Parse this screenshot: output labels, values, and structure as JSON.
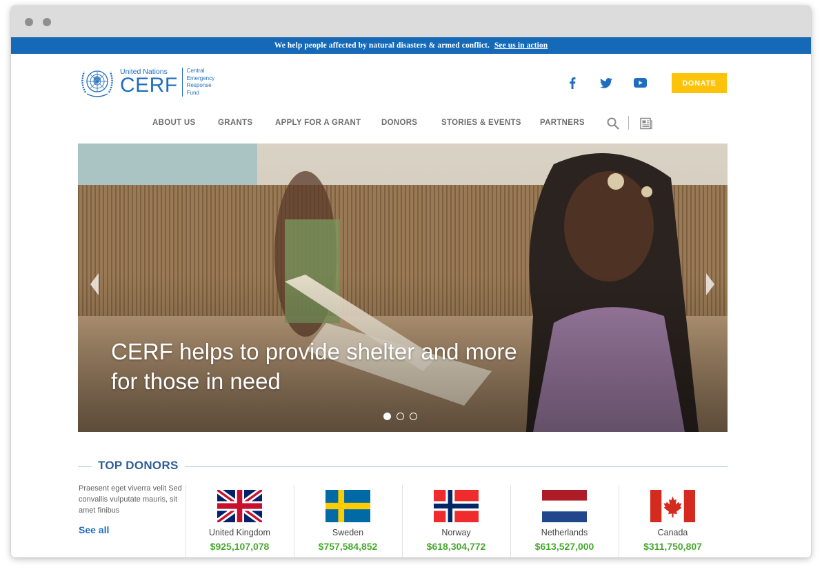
{
  "announcement": {
    "text": "We help people affected by natural disasters & armed conflict.",
    "link": "See us in action"
  },
  "logo": {
    "united_nations": "United Nations",
    "acronym": "CERF",
    "subtitle_lines": [
      "Central",
      "Emergency",
      "Response",
      "Fund"
    ]
  },
  "social": [
    "facebook-icon",
    "twitter-icon",
    "youtube-icon"
  ],
  "donate_label": "DONATE",
  "nav": {
    "items": [
      "ABOUT US",
      "GRANTS",
      "APPLY FOR A GRANT",
      "DONORS",
      "STORIES & EVENTS",
      "PARTNERS"
    ]
  },
  "hero": {
    "title": "CERF helps to provide shelter and more for those in need",
    "slides": 3,
    "active_slide": 1
  },
  "top_donors": {
    "title": "TOP DONORS",
    "description": "Praesent eget viverra velit Sed convallis vulputate mauris, sit amet finibus",
    "see_all": "See all",
    "donors": [
      {
        "country": "United Kingdom",
        "amount": "$925,107,078"
      },
      {
        "country": "Sweden",
        "amount": "$757,584,852"
      },
      {
        "country": "Norway",
        "amount": "$618,304,772"
      },
      {
        "country": "Netherlands",
        "amount": "$613,527,000"
      },
      {
        "country": "Canada",
        "amount": "$311,750,807"
      }
    ]
  },
  "colors": {
    "brand_blue": "#1569b7",
    "donate_yellow": "#fdc20a",
    "amount_green": "#46a92d",
    "heading_blue": "#2d5f96"
  }
}
